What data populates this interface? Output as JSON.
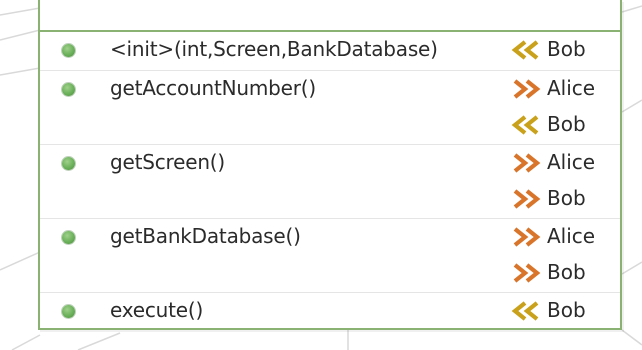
{
  "methods": [
    {
      "name": "<init>(int,Screen,BankDatabase)",
      "authors": [
        {
          "name": "Bob",
          "direction": "left"
        }
      ]
    },
    {
      "name": "getAccountNumber()",
      "authors": [
        {
          "name": "Alice",
          "direction": "right"
        },
        {
          "name": "Bob",
          "direction": "left"
        }
      ]
    },
    {
      "name": "getScreen()",
      "authors": [
        {
          "name": "Alice",
          "direction": "right"
        },
        {
          "name": "Bob",
          "direction": "right"
        }
      ]
    },
    {
      "name": "getBankDatabase()",
      "authors": [
        {
          "name": "Alice",
          "direction": "right"
        },
        {
          "name": "Bob",
          "direction": "right"
        }
      ]
    },
    {
      "name": "execute()",
      "authors": [
        {
          "name": "Bob",
          "direction": "left"
        }
      ]
    }
  ],
  "colors": {
    "border": "#8ab273",
    "dot": "#6bb05a",
    "arrow_left": "#c9a11a",
    "arrow_right": "#d8752a",
    "text": "#2b2b2b"
  },
  "icons": {
    "method": "public-method-dot-icon",
    "arrow_left": "chevron-double-left-icon",
    "arrow_right": "chevron-double-right-icon"
  }
}
